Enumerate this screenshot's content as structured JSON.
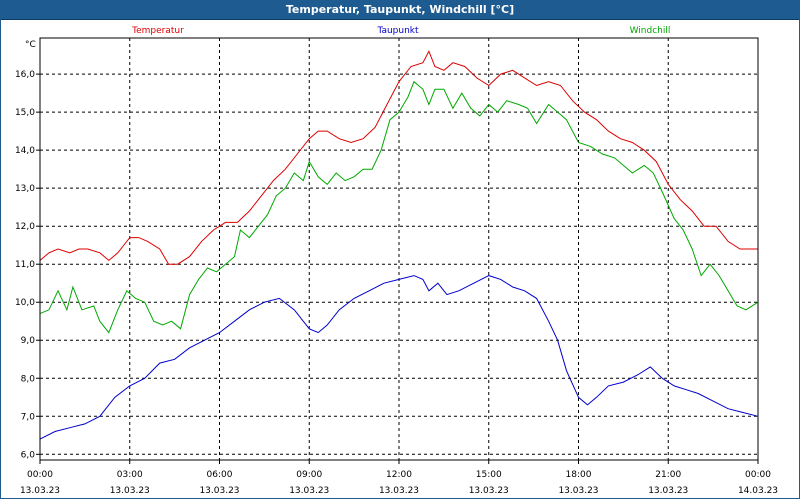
{
  "window": {
    "title": "Temperatur, Taupunkt, Windchill [°C]"
  },
  "chart_data": {
    "type": "line",
    "title": "Temperatur, Taupunkt, Windchill [°C]",
    "ylabel": "°C",
    "ylim": [
      5.85,
      16.95
    ],
    "grid": true,
    "legend_position": "top",
    "y_ticks": [
      "6,0",
      "7,0",
      "8,0",
      "9,0",
      "10,0",
      "11,0",
      "12,0",
      "13,0",
      "14,0",
      "15,0",
      "16,0"
    ],
    "y_tick_values": [
      6,
      7,
      8,
      9,
      10,
      11,
      12,
      13,
      14,
      15,
      16
    ],
    "x_ticks": [
      {
        "time": "00:00",
        "date": "13.03.23"
      },
      {
        "time": "03:00",
        "date": "13.03.23"
      },
      {
        "time": "06:00",
        "date": "13.03.23"
      },
      {
        "time": "09:00",
        "date": "13.03.23"
      },
      {
        "time": "12:00",
        "date": "13.03.23"
      },
      {
        "time": "15:00",
        "date": "13.03.23"
      },
      {
        "time": "18:00",
        "date": "13.03.23"
      },
      {
        "time": "21:00",
        "date": "13.03.23"
      },
      {
        "time": "00:00",
        "date": "14.03.23"
      }
    ],
    "x_tick_hours": [
      0,
      3,
      6,
      9,
      12,
      15,
      18,
      21,
      24
    ],
    "x_unit": "hours",
    "series": [
      {
        "name": "Temperatur",
        "color": "#dd0000",
        "points": [
          [
            0,
            11.1
          ],
          [
            0.3,
            11.3
          ],
          [
            0.6,
            11.4
          ],
          [
            1.0,
            11.3
          ],
          [
            1.3,
            11.4
          ],
          [
            1.6,
            11.4
          ],
          [
            2.0,
            11.3
          ],
          [
            2.3,
            11.1
          ],
          [
            2.6,
            11.3
          ],
          [
            3.0,
            11.7
          ],
          [
            3.3,
            11.7
          ],
          [
            3.6,
            11.6
          ],
          [
            4.0,
            11.4
          ],
          [
            4.3,
            11.0
          ],
          [
            4.6,
            11.0
          ],
          [
            5.0,
            11.2
          ],
          [
            5.4,
            11.6
          ],
          [
            5.8,
            11.9
          ],
          [
            6.2,
            12.1
          ],
          [
            6.6,
            12.1
          ],
          [
            7.0,
            12.4
          ],
          [
            7.4,
            12.8
          ],
          [
            7.8,
            13.2
          ],
          [
            8.2,
            13.5
          ],
          [
            8.6,
            13.9
          ],
          [
            9.0,
            14.3
          ],
          [
            9.3,
            14.5
          ],
          [
            9.6,
            14.5
          ],
          [
            10.0,
            14.3
          ],
          [
            10.4,
            14.2
          ],
          [
            10.8,
            14.3
          ],
          [
            11.2,
            14.6
          ],
          [
            11.6,
            15.2
          ],
          [
            12.0,
            15.8
          ],
          [
            12.4,
            16.2
          ],
          [
            12.8,
            16.3
          ],
          [
            13.0,
            16.6
          ],
          [
            13.2,
            16.2
          ],
          [
            13.5,
            16.1
          ],
          [
            13.8,
            16.3
          ],
          [
            14.2,
            16.2
          ],
          [
            14.6,
            15.9
          ],
          [
            15.0,
            15.7
          ],
          [
            15.4,
            16.0
          ],
          [
            15.8,
            16.1
          ],
          [
            16.2,
            15.9
          ],
          [
            16.6,
            15.7
          ],
          [
            17.0,
            15.8
          ],
          [
            17.4,
            15.7
          ],
          [
            17.8,
            15.3
          ],
          [
            18.2,
            15.0
          ],
          [
            18.6,
            14.8
          ],
          [
            19.0,
            14.5
          ],
          [
            19.4,
            14.3
          ],
          [
            19.8,
            14.2
          ],
          [
            20.2,
            14.0
          ],
          [
            20.6,
            13.7
          ],
          [
            21.0,
            13.1
          ],
          [
            21.4,
            12.7
          ],
          [
            21.8,
            12.4
          ],
          [
            22.2,
            12.0
          ],
          [
            22.6,
            12.0
          ],
          [
            23.0,
            11.6
          ],
          [
            23.4,
            11.4
          ],
          [
            23.8,
            11.4
          ],
          [
            24.0,
            11.4
          ]
        ]
      },
      {
        "name": "Taupunkt",
        "color": "#0000cc",
        "points": [
          [
            0,
            6.4
          ],
          [
            0.5,
            6.6
          ],
          [
            1.0,
            6.7
          ],
          [
            1.5,
            6.8
          ],
          [
            2.0,
            7.0
          ],
          [
            2.5,
            7.5
          ],
          [
            3.0,
            7.8
          ],
          [
            3.5,
            8.0
          ],
          [
            4.0,
            8.4
          ],
          [
            4.5,
            8.5
          ],
          [
            5.0,
            8.8
          ],
          [
            5.5,
            9.0
          ],
          [
            6.0,
            9.2
          ],
          [
            6.5,
            9.5
          ],
          [
            7.0,
            9.8
          ],
          [
            7.5,
            10.0
          ],
          [
            8.0,
            10.1
          ],
          [
            8.5,
            9.8
          ],
          [
            9.0,
            9.3
          ],
          [
            9.3,
            9.2
          ],
          [
            9.6,
            9.4
          ],
          [
            10.0,
            9.8
          ],
          [
            10.5,
            10.1
          ],
          [
            11.0,
            10.3
          ],
          [
            11.5,
            10.5
          ],
          [
            12.0,
            10.6
          ],
          [
            12.5,
            10.7
          ],
          [
            12.8,
            10.6
          ],
          [
            13.0,
            10.3
          ],
          [
            13.3,
            10.5
          ],
          [
            13.6,
            10.2
          ],
          [
            14.0,
            10.3
          ],
          [
            14.5,
            10.5
          ],
          [
            15.0,
            10.7
          ],
          [
            15.4,
            10.6
          ],
          [
            15.8,
            10.4
          ],
          [
            16.2,
            10.3
          ],
          [
            16.6,
            10.1
          ],
          [
            17.0,
            9.5
          ],
          [
            17.3,
            9.0
          ],
          [
            17.6,
            8.2
          ],
          [
            18.0,
            7.5
          ],
          [
            18.3,
            7.3
          ],
          [
            18.6,
            7.5
          ],
          [
            19.0,
            7.8
          ],
          [
            19.5,
            7.9
          ],
          [
            20.0,
            8.1
          ],
          [
            20.4,
            8.3
          ],
          [
            20.8,
            8.0
          ],
          [
            21.2,
            7.8
          ],
          [
            21.6,
            7.7
          ],
          [
            22.0,
            7.6
          ],
          [
            22.5,
            7.4
          ],
          [
            23.0,
            7.2
          ],
          [
            23.5,
            7.1
          ],
          [
            24.0,
            7.0
          ]
        ]
      },
      {
        "name": "Windchill",
        "color": "#00a800",
        "points": [
          [
            0,
            9.7
          ],
          [
            0.3,
            9.8
          ],
          [
            0.6,
            10.3
          ],
          [
            0.9,
            9.8
          ],
          [
            1.1,
            10.4
          ],
          [
            1.4,
            9.8
          ],
          [
            1.8,
            9.9
          ],
          [
            2.0,
            9.5
          ],
          [
            2.3,
            9.2
          ],
          [
            2.6,
            9.8
          ],
          [
            2.9,
            10.3
          ],
          [
            3.2,
            10.1
          ],
          [
            3.5,
            10.0
          ],
          [
            3.8,
            9.5
          ],
          [
            4.1,
            9.4
          ],
          [
            4.4,
            9.5
          ],
          [
            4.7,
            9.3
          ],
          [
            5.0,
            10.2
          ],
          [
            5.3,
            10.6
          ],
          [
            5.6,
            10.9
          ],
          [
            5.9,
            10.8
          ],
          [
            6.2,
            11.0
          ],
          [
            6.5,
            11.2
          ],
          [
            6.7,
            11.9
          ],
          [
            7.0,
            11.7
          ],
          [
            7.3,
            12.0
          ],
          [
            7.6,
            12.3
          ],
          [
            7.9,
            12.8
          ],
          [
            8.2,
            13.0
          ],
          [
            8.5,
            13.4
          ],
          [
            8.8,
            13.2
          ],
          [
            9.0,
            13.7
          ],
          [
            9.3,
            13.3
          ],
          [
            9.6,
            13.1
          ],
          [
            9.9,
            13.4
          ],
          [
            10.2,
            13.2
          ],
          [
            10.5,
            13.3
          ],
          [
            10.8,
            13.5
          ],
          [
            11.1,
            13.5
          ],
          [
            11.4,
            14.0
          ],
          [
            11.7,
            14.8
          ],
          [
            12.0,
            15.0
          ],
          [
            12.3,
            15.4
          ],
          [
            12.5,
            15.8
          ],
          [
            12.8,
            15.6
          ],
          [
            13.0,
            15.2
          ],
          [
            13.2,
            15.6
          ],
          [
            13.5,
            15.6
          ],
          [
            13.8,
            15.1
          ],
          [
            14.1,
            15.5
          ],
          [
            14.4,
            15.1
          ],
          [
            14.7,
            14.9
          ],
          [
            15.0,
            15.2
          ],
          [
            15.3,
            15.0
          ],
          [
            15.6,
            15.3
          ],
          [
            16.0,
            15.2
          ],
          [
            16.3,
            15.1
          ],
          [
            16.6,
            14.7
          ],
          [
            17.0,
            15.2
          ],
          [
            17.3,
            15.0
          ],
          [
            17.6,
            14.8
          ],
          [
            18.0,
            14.2
          ],
          [
            18.4,
            14.1
          ],
          [
            18.8,
            13.9
          ],
          [
            19.2,
            13.8
          ],
          [
            19.5,
            13.6
          ],
          [
            19.8,
            13.4
          ],
          [
            20.2,
            13.6
          ],
          [
            20.5,
            13.4
          ],
          [
            20.8,
            12.9
          ],
          [
            21.2,
            12.2
          ],
          [
            21.5,
            11.9
          ],
          [
            21.8,
            11.4
          ],
          [
            22.1,
            10.7
          ],
          [
            22.4,
            11.0
          ],
          [
            22.7,
            10.7
          ],
          [
            23.0,
            10.3
          ],
          [
            23.3,
            9.9
          ],
          [
            23.6,
            9.8
          ],
          [
            24.0,
            10.0
          ]
        ]
      }
    ]
  }
}
